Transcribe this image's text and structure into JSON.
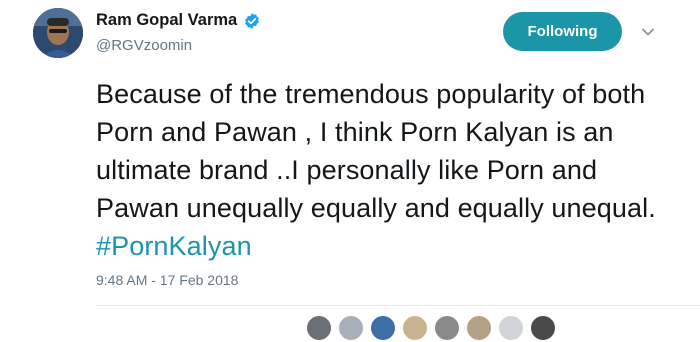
{
  "user": {
    "name": "Ram Gopal Varma",
    "handle": "@RGVzoomin",
    "verified": true
  },
  "follow_button": {
    "label": "Following"
  },
  "tweet": {
    "text_before": "Because of the tremendous popularity of both Porn and Pawan , I think Porn Kalyan is an ultimate brand ..I personally like Porn and Pawan unequally equally and equally unequal. ",
    "hashtag": "#PornKalyan",
    "timestamp": "9:48 AM - 17 Feb 2018"
  },
  "colors": {
    "accent": "#1b95a8",
    "verified_badge": "#1da1f2",
    "secondary_text": "#657786"
  },
  "likers": [
    {
      "color": "#6b6f76"
    },
    {
      "color": "#a7b0ba"
    },
    {
      "color": "#3c6fa8"
    },
    {
      "color": "#c8b58f"
    },
    {
      "color": "#8a8a8a"
    },
    {
      "color": "#b5a188"
    },
    {
      "color": "#d1d5da"
    },
    {
      "color": "#4a4a4a"
    }
  ]
}
